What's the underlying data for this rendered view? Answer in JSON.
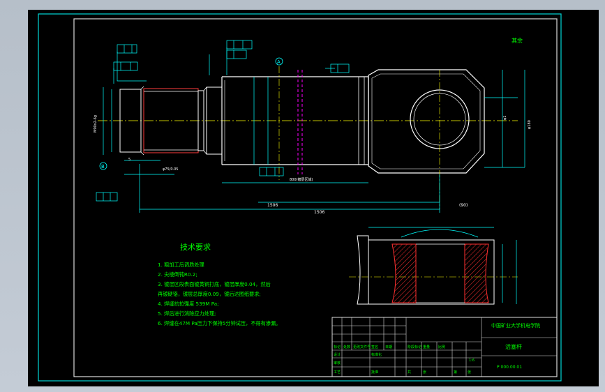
{
  "drawing": {
    "corner_note": "其余",
    "datum_labels": {
      "a": "A",
      "b": "B"
    },
    "section_title": "技术要求",
    "requirements": [
      "1. 粗加工后调质处理",
      "2. 尖棱倒钝R0.2;",
      "3. 镀层区段表面镀黄铜打底，镀层厚度0.04，然后",
      "   再镀硬铬，镀层总厚度0.09，镀后达图纸要求;",
      "4. 焊缝抗拉强度 539M Pa;",
      "5. 焊后进行消除应力处理;",
      "6. 焊缝在47M Pa压力下保持5分钟试压，不得有渗漏。"
    ],
    "dimensions": {
      "overall_length": "1506",
      "shaft_length": "1506",
      "head_length": "(90)",
      "head_width": "φ180",
      "hole_dia": "φ1",
      "chrome_zone": "800(镀层区域)",
      "rod_dia": "φ75/0.05",
      "thread": "M90x2-6g",
      "end_len": "5"
    }
  },
  "title_block": {
    "company": "中国矿业大学机电学院",
    "drawing_name": "活塞杆",
    "drawing_no": "P 000.00.01",
    "scale": "1:6",
    "cells": [
      "标记",
      "处数",
      "更改文件号",
      "签名",
      "日期",
      "设计",
      "标准化",
      "审核",
      "工艺",
      "批准",
      "阶段标记",
      "重量",
      "比例",
      "共",
      "张",
      "第",
      "张"
    ]
  },
  "colors": {
    "background": "#000000",
    "frame": "#dcdcdc",
    "outline": "#ffffff",
    "dimension": "#00ffff",
    "centerline": "#ffff00",
    "chrome_zone": "#ff00ff",
    "section_hatch": "#ff3030",
    "text": "#00ff00",
    "outer_border": "#00d8d8"
  }
}
